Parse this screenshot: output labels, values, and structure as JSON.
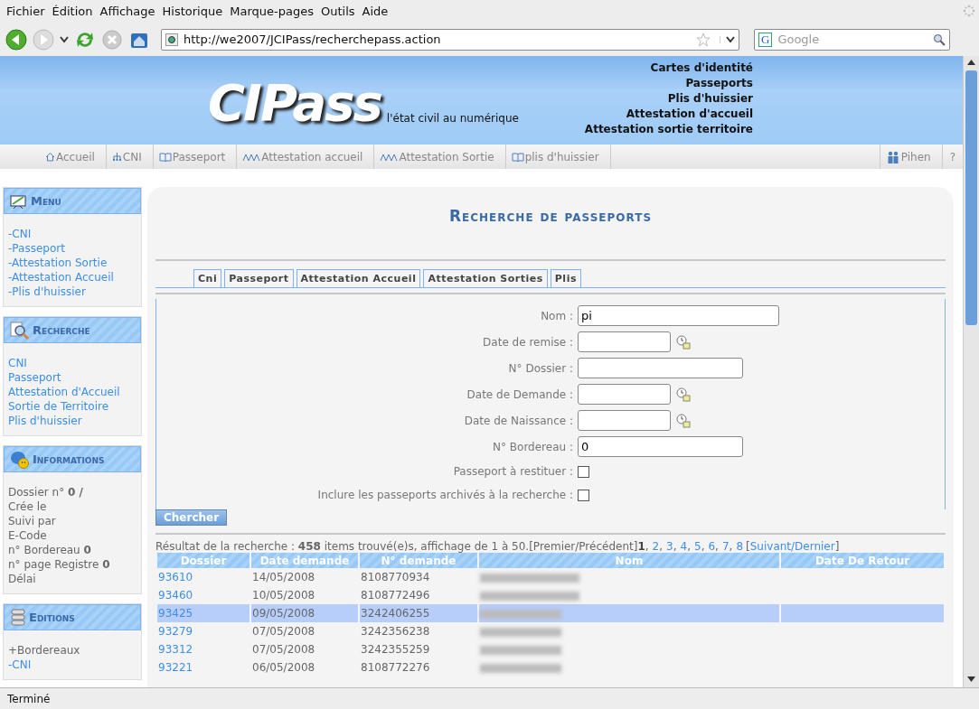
{
  "menu_bar": [
    "Fichier",
    "Édition",
    "Affichage",
    "Historique",
    "Marque-pages",
    "Outils",
    "Aide"
  ],
  "toolbar": {
    "url": "http://we2007/JCIPass/recherchepass.action",
    "search_placeholder": "Google",
    "search_engine": "G"
  },
  "header": {
    "logo": "CIPass",
    "tagline": "l'état civil au numérique",
    "links": [
      "Cartes d'identité",
      "Passeports",
      "Plis d'huissier",
      "Attestation d'accueil",
      "Attestation sortie territoire"
    ]
  },
  "nav": [
    {
      "label": "Accueil",
      "kind": "home"
    },
    {
      "label": "CNI",
      "kind": "tree"
    },
    {
      "label": "Passeport",
      "kind": "book"
    },
    {
      "label": "Attestation accueil",
      "kind": "people"
    },
    {
      "label": "Attestation Sortie",
      "kind": "people"
    },
    {
      "label": "plis d'huissier",
      "kind": "book"
    }
  ],
  "nav_right": {
    "user": "Pihen",
    "help": "?"
  },
  "sidebar": [
    {
      "title": "Menu",
      "kind": "menu",
      "items": [
        {
          "label": "-CNI",
          "kind": "link"
        },
        {
          "label": "-Passeport",
          "kind": "link"
        },
        {
          "label": "-Attestation Sortie",
          "kind": "link"
        },
        {
          "label": "-Attestation Accueil",
          "kind": "link"
        },
        {
          "label": "-Plis d'huissier",
          "kind": "link"
        }
      ]
    },
    {
      "title": "Recherche",
      "kind": "search",
      "items": [
        {
          "label": "CNI",
          "kind": "link"
        },
        {
          "label": "Passeport",
          "kind": "link"
        },
        {
          "label": "Attestation d'Accueil",
          "kind": "link"
        },
        {
          "label": "Sortie de Territoire",
          "kind": "link"
        },
        {
          "label": "Plis d'huissier",
          "kind": "link"
        }
      ]
    },
    {
      "title": "Informations",
      "kind": "info",
      "items": [
        {
          "label": "Dossier n° **0 /**",
          "kind": "text"
        },
        {
          "label": "Crée le",
          "kind": "text"
        },
        {
          "label": "Suivi par",
          "kind": "text"
        },
        {
          "label": "E-Code",
          "kind": "text"
        },
        {
          "label": "n° Bordereau **0**",
          "kind": "text"
        },
        {
          "label": "n° page Registre **0**",
          "kind": "text"
        },
        {
          "label": "Délai",
          "kind": "text"
        }
      ]
    },
    {
      "title": "Editions",
      "kind": "db",
      "items": [
        {
          "label": "+Bordereaux",
          "kind": "text"
        },
        {
          "label": "-CNI",
          "kind": "link"
        }
      ]
    }
  ],
  "main": {
    "title": "Recherche de passeports",
    "tabs": [
      "Cni",
      "Passeport",
      "Attestation Accueil",
      "Attestation Sorties",
      "Plis"
    ],
    "form": [
      {
        "label": "Nom :",
        "kind": "text",
        "value": "pi"
      },
      {
        "label": "Date de remise :",
        "kind": "date"
      },
      {
        "label": "N° Dossier :",
        "kind": "text"
      },
      {
        "label": "Date de Demande :",
        "kind": "date"
      },
      {
        "label": "Date de Naissance :",
        "kind": "date"
      },
      {
        "label": "N° Bordereau :",
        "kind": "text",
        "value": "0"
      },
      {
        "label": "Passeport à restituer :",
        "kind": "checkbox",
        "checked": false
      },
      {
        "label": "Inclure les passeports archivés à la recherche :",
        "kind": "checkbox",
        "checked": false
      }
    ],
    "submit": "Chercher",
    "results": {
      "summary": "Résultat de la recherche : **458** items trouvé(e)s, affichage de 1 à 50.",
      "first_prev": "[Premier/Précédent]",
      "pages": [
        {
          "label": "1",
          "selected": true
        },
        {
          "label": "2",
          "selected": false
        },
        {
          "label": "3",
          "selected": false
        },
        {
          "label": "4",
          "selected": false
        },
        {
          "label": "5",
          "selected": false
        },
        {
          "label": "6",
          "selected": false
        },
        {
          "label": "7",
          "selected": false
        },
        {
          "label": "8",
          "selected": false
        }
      ],
      "separator": ",",
      "bracket_open": "[",
      "next_last": "Suivant/Dernier",
      "bracket_close": "]"
    },
    "table": {
      "columns": [
        "Dossier",
        "Date demande",
        "N° demande",
        "Nom",
        "Date De Retour"
      ],
      "rows": [
        {
          "dossier": "93610",
          "date": "14/05/2008",
          "numero": "8108770934",
          "selected": false
        },
        {
          "dossier": "93460",
          "date": "10/05/2008",
          "numero": "8108772496",
          "selected": false
        },
        {
          "dossier": "93425",
          "date": "09/05/2008",
          "numero": "3242406255",
          "selected": true
        },
        {
          "dossier": "93279",
          "date": "07/05/2008",
          "numero": "3242356238",
          "selected": false
        },
        {
          "dossier": "93312",
          "date": "07/05/2008",
          "numero": "3242355259",
          "selected": false
        },
        {
          "dossier": "93221",
          "date": "06/05/2008",
          "numero": "8108772276",
          "selected": false
        }
      ]
    }
  },
  "status_bar": "Terminé"
}
